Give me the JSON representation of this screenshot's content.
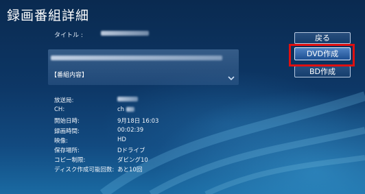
{
  "page": {
    "title": "録画番組詳細"
  },
  "details": {
    "title_label": "タイトル :",
    "description_heading": "【番組内容】"
  },
  "info": [
    {
      "label": "放送局:",
      "value": ""
    },
    {
      "label": "CH:",
      "value": "ch"
    },
    {
      "label": "開始日時:",
      "value": "9月18日 16:03"
    },
    {
      "label": "録画時間:",
      "value": "00:02:39"
    },
    {
      "label": "映像:",
      "value": "HD"
    },
    {
      "label": "保存場所:",
      "value": "Dドライブ"
    },
    {
      "label": "コピー制限:",
      "value": "ダビング10"
    },
    {
      "label": "ディスク作成可能回数:",
      "value": "あと10回"
    }
  ],
  "buttons": {
    "back": "戻る",
    "dvd": "DVD作成",
    "bd": "BD作成"
  },
  "colors": {
    "highlight": "#e01010",
    "background": "#0d3766"
  },
  "icons": {
    "expand": "chevron-down-icon"
  }
}
